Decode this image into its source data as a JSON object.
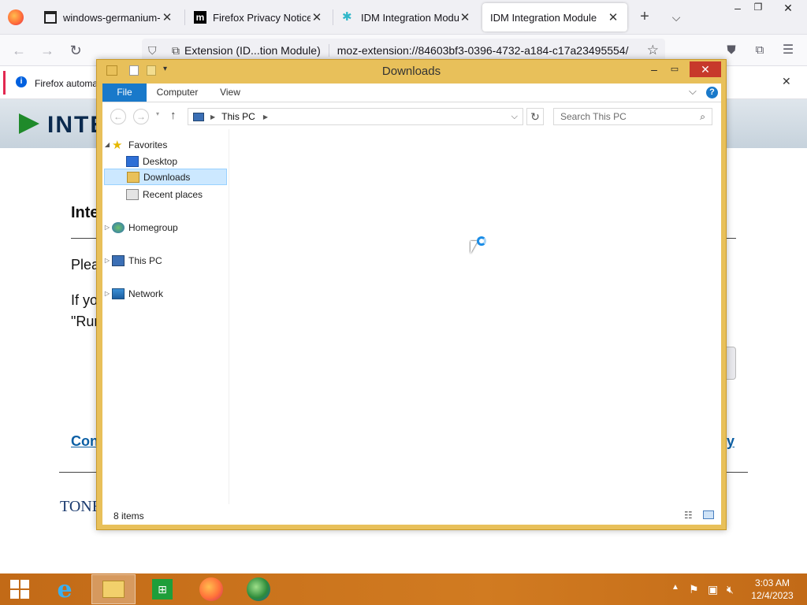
{
  "browser": {
    "tabs": [
      {
        "label": "windows-germanium-ar",
        "icon": "museum-icon"
      },
      {
        "label": "Firefox Privacy Notice —",
        "icon": "mozilla-m-icon"
      },
      {
        "label": "IDM Integration Module",
        "icon": "idm-puzzle-icon"
      },
      {
        "label": "IDM Integration Module",
        "active": true
      }
    ],
    "identity_label": "Extension (ID...tion Module)",
    "url": "moz-extension://84603bf3-0396-4732-a184-c17a23495554/",
    "notification": "Firefox automa",
    "page_heading_partial": "Inte",
    "page_text_1": "Plea",
    "page_text_2": "If yo",
    "page_text_3": "\"Rur",
    "page_link_partial": "Con",
    "page_link_right_partial": "cy",
    "banner_text": "INTE",
    "footer_logo": "TONE"
  },
  "explorer": {
    "title": "Downloads",
    "ribbon_tabs": {
      "file": "File",
      "computer": "Computer",
      "view": "View"
    },
    "address_location": "This PC",
    "search_placeholder": "Search This PC",
    "nav": {
      "favorites": "Favorites",
      "desktop": "Desktop",
      "downloads": "Downloads",
      "recent": "Recent places",
      "homegroup": "Homegroup",
      "thispc": "This PC",
      "network": "Network"
    },
    "status": "8 items"
  },
  "taskbar": {
    "time": "3:03 AM",
    "date": "12/4/2023"
  },
  "colors": {
    "window_frame": "#e8c05a",
    "taskbar": "#d17b21",
    "selection": "#cce8ff",
    "file_tab": "#1979ca"
  }
}
